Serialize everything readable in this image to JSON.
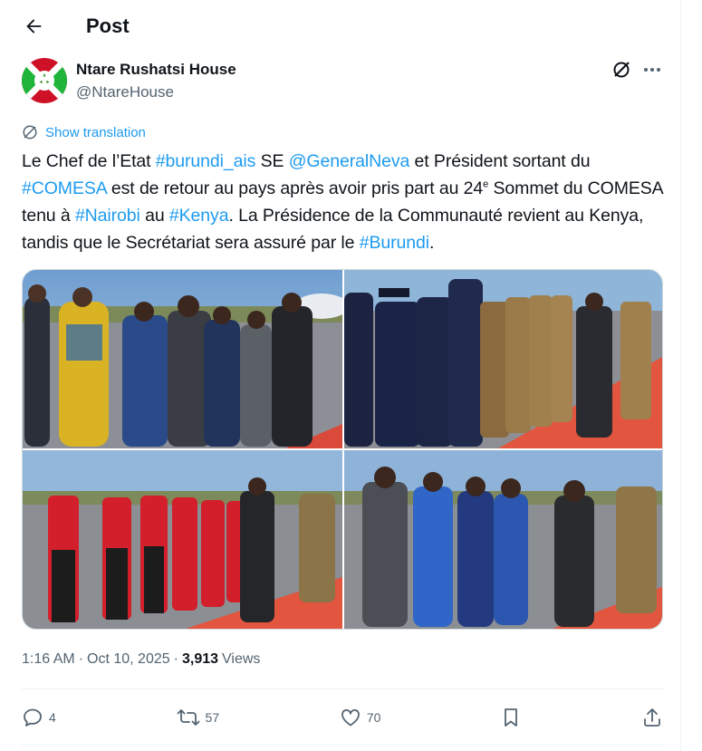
{
  "header": {
    "title": "Post"
  },
  "author": {
    "name": "Ntare Rushatsi House",
    "handle": "@NtareHouse"
  },
  "translation": {
    "label": "Show translation"
  },
  "tweet": {
    "t1": "Le Chef de l’Etat ",
    "l1": "#burundi_ais",
    "t2": " SE ",
    "l2": "@GeneralNeva",
    "t3": " et Président sortant du ",
    "l3": "#COMESA",
    "t4": " est de retour au pays après avoir pris part au 24",
    "sup": "e",
    "t5": " Sommet du COMESA tenu à ",
    "l4": "#Nairobi",
    "t6": " au ",
    "l5": "#Kenya",
    "t7": ". La Présidence de la Communauté revient au Kenya, tandis que le Secrétariat sera assuré par le ",
    "l6": "#Burundi",
    "t8": "."
  },
  "meta": {
    "time": "1:16 AM",
    "sep1": "·",
    "date": "Oct 10, 2025",
    "sep2": "·",
    "views_count": "3,913",
    "views_label": "Views"
  },
  "actions": {
    "replies": "4",
    "reposts": "57",
    "likes": "70"
  },
  "icons": {
    "back": "arrow-left-icon",
    "grok": "grok-icon",
    "more": "more-icon",
    "translate": "globe-icon",
    "reply": "reply-icon",
    "repost": "repost-icon",
    "like": "heart-icon",
    "bookmark": "bookmark-icon",
    "share": "share-icon"
  },
  "colors": {
    "link": "#1d9bf0",
    "muted": "#536471",
    "text": "#0f1419",
    "carpet": "#e2553f",
    "burundi_red": "#ce1126",
    "burundi_green": "#1eb53a"
  }
}
